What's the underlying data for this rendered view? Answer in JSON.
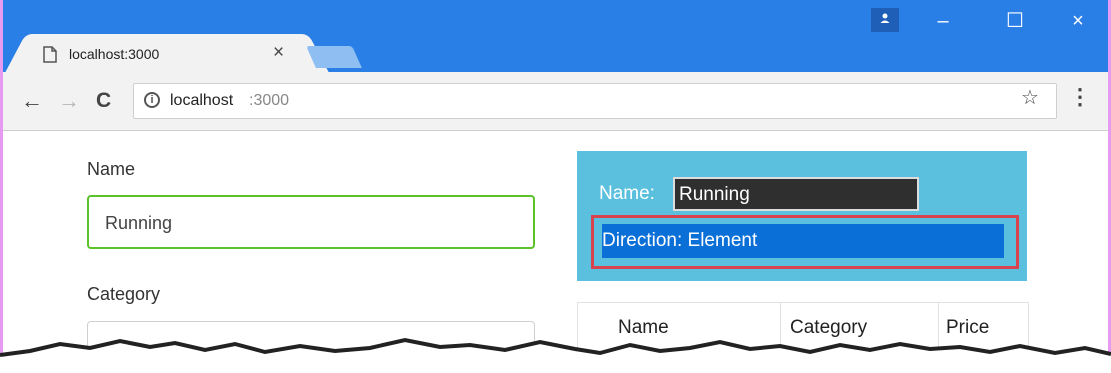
{
  "browser": {
    "tab_title": "localhost:3000",
    "tab_close": "×",
    "url_host": "localhost",
    "url_port": ":3000",
    "window_minimize": "–",
    "window_maximize": "☐",
    "window_close": "×",
    "accent_color": "#2a7fe6"
  },
  "form": {
    "name_label": "Name",
    "name_value": "Running",
    "category_label": "Category",
    "category_value": ""
  },
  "info_panel": {
    "name_label": "Name:",
    "name_value": "Running",
    "direction_text": "Direction: Element",
    "highlight_color": "#d9434e"
  },
  "table": {
    "headers": [
      "Name",
      "Category",
      "Price"
    ]
  },
  "icons": [
    "page-icon",
    "back-arrow-icon",
    "forward-arrow-icon",
    "reload-icon",
    "info-icon",
    "star-icon",
    "menu-icon",
    "profile-icon"
  ]
}
